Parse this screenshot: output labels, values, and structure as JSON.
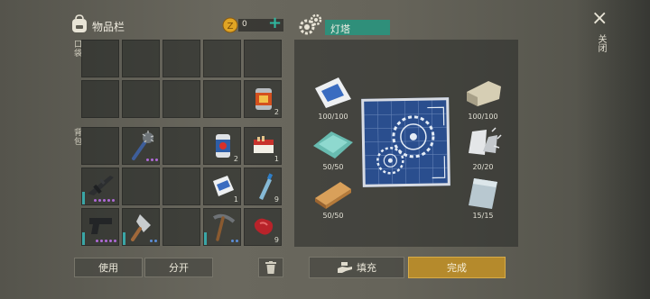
{
  "inventory": {
    "title": "物品栏",
    "coins": "0",
    "plus": "+",
    "pocket_label": "口袋",
    "backpack_label": "背包",
    "slots": {
      "can": "2",
      "soda": "2",
      "cigs": "1",
      "cement": "1",
      "bottle": "9",
      "meat": "9"
    }
  },
  "craft": {
    "name": "灯塔",
    "materials": {
      "cement_bag": "100/100",
      "stone": "100/100",
      "glass": "50/50",
      "scrap": "20/20",
      "wood": "50/50",
      "plate": "15/15"
    }
  },
  "buttons": {
    "use": "使用",
    "split": "分开",
    "fill": "填充",
    "done": "完成"
  },
  "close": {
    "label": "关闭",
    "icon": "×"
  },
  "colors": {
    "accent_green": "#2f8f7a",
    "done_gold": "#c2942e",
    "rarity_purple": "#b06ad8",
    "rarity_blue": "#5c8ed8"
  }
}
